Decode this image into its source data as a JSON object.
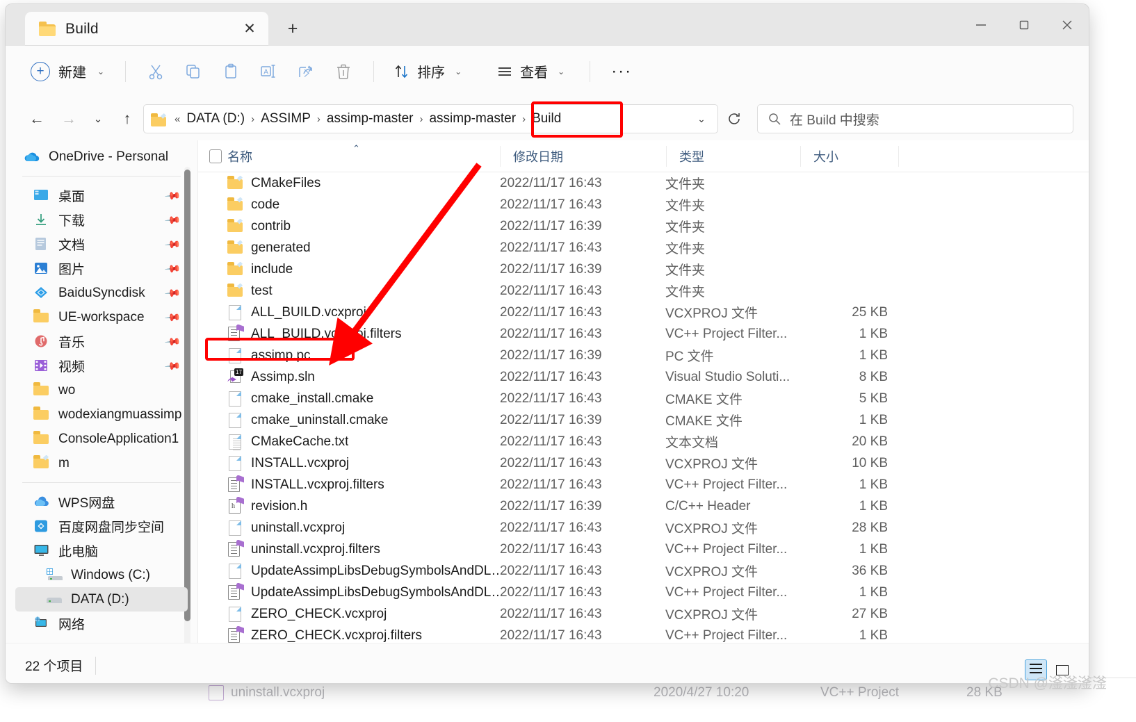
{
  "window": {
    "tab_title": "Build",
    "tab_close_glyph": "✕",
    "new_tab_glyph": "+",
    "minimize_glyph": "—",
    "maximize_glyph": "□",
    "close_glyph": "✕"
  },
  "toolbar": {
    "new_label": "新建",
    "cut_label": "剪切",
    "copy_label": "复制",
    "paste_label": "粘贴",
    "rename_label": "重命名",
    "share_label": "共享",
    "delete_label": "删除",
    "sort_label": "排序",
    "view_label": "查看",
    "more_label": "···",
    "chevron": "⌄"
  },
  "address": {
    "back_glyph": "←",
    "forward_glyph": "→",
    "recent_glyph": "⌄",
    "up_glyph": "↑",
    "prefix": "«",
    "crumbs": [
      "DATA (D:)",
      "ASSIMP",
      "assimp-master",
      "assimp-master",
      "Build"
    ],
    "separator": "›",
    "dropdown_glyph": "⌄",
    "refresh_glyph": "⟳"
  },
  "search": {
    "placeholder": "在 Build 中搜索"
  },
  "sidebar": {
    "onedrive": {
      "label": "OneDrive - Personal"
    },
    "quick": [
      {
        "label": "桌面",
        "icon": "desktop-icon",
        "pinned": true
      },
      {
        "label": "下载",
        "icon": "download-icon",
        "pinned": true
      },
      {
        "label": "文档",
        "icon": "documents-icon",
        "pinned": true
      },
      {
        "label": "图片",
        "icon": "pictures-icon",
        "pinned": true
      },
      {
        "label": "BaiduSyncdisk",
        "icon": "baidu-icon",
        "pinned": true
      },
      {
        "label": "UE-workspace",
        "icon": "folder-icon",
        "pinned": true
      },
      {
        "label": "音乐",
        "icon": "music-icon",
        "pinned": true
      },
      {
        "label": "视频",
        "icon": "video-icon",
        "pinned": true
      },
      {
        "label": "wo",
        "icon": "folder-icon",
        "pinned": false
      },
      {
        "label": "wodexiangmuassimp",
        "icon": "folder-icon",
        "pinned": false
      },
      {
        "label": "ConsoleApplication1",
        "icon": "folder-icon",
        "pinned": false
      },
      {
        "label": "m",
        "icon": "folder-shortcut-icon",
        "pinned": false
      }
    ],
    "devices": [
      {
        "label": "WPS网盘",
        "icon": "wps-cloud-icon",
        "indent": 0,
        "selected": false
      },
      {
        "label": "百度网盘同步空间",
        "icon": "baidu-cloud-icon",
        "indent": 0,
        "selected": false
      },
      {
        "label": "此电脑",
        "icon": "this-pc-icon",
        "indent": 0,
        "selected": false
      },
      {
        "label": "Windows (C:)",
        "icon": "windows-drive-icon",
        "indent": 1,
        "selected": false
      },
      {
        "label": "DATA (D:)",
        "icon": "drive-icon",
        "indent": 1,
        "selected": true
      },
      {
        "label": "网络",
        "icon": "network-icon",
        "indent": 0,
        "selected": false
      }
    ]
  },
  "columns": {
    "name": "名称",
    "date": "修改日期",
    "type": "类型",
    "size": "大小",
    "sort_caret": "⌃"
  },
  "files": [
    {
      "name": "CMakeFiles",
      "icon": "folder-shortcut-icon",
      "date": "2022/11/17 16:43",
      "type": "文件夹",
      "size": ""
    },
    {
      "name": "code",
      "icon": "folder-shortcut-icon",
      "date": "2022/11/17 16:43",
      "type": "文件夹",
      "size": ""
    },
    {
      "name": "contrib",
      "icon": "folder-shortcut-icon",
      "date": "2022/11/17 16:39",
      "type": "文件夹",
      "size": ""
    },
    {
      "name": "generated",
      "icon": "folder-shortcut-icon",
      "date": "2022/11/17 16:43",
      "type": "文件夹",
      "size": ""
    },
    {
      "name": "include",
      "icon": "folder-shortcut-icon",
      "date": "2022/11/17 16:39",
      "type": "文件夹",
      "size": ""
    },
    {
      "name": "test",
      "icon": "folder-shortcut-icon",
      "date": "2022/11/17 16:43",
      "type": "文件夹",
      "size": ""
    },
    {
      "name": "ALL_BUILD.vcxproj",
      "icon": "generic-file-icon",
      "date": "2022/11/17 16:43",
      "type": "VCXPROJ 文件",
      "size": "25 KB"
    },
    {
      "name": "ALL_BUILD.vcxproj.filters",
      "icon": "filters-file-icon",
      "date": "2022/11/17 16:43",
      "type": "VC++ Project Filter...",
      "size": "1 KB"
    },
    {
      "name": "assimp.pc",
      "icon": "generic-file-icon",
      "date": "2022/11/17 16:39",
      "type": "PC 文件",
      "size": "1 KB"
    },
    {
      "name": "Assimp.sln",
      "icon": "visual-studio-sln-icon",
      "date": "2022/11/17 16:43",
      "type": "Visual Studio Soluti...",
      "size": "8 KB"
    },
    {
      "name": "cmake_install.cmake",
      "icon": "generic-file-icon",
      "date": "2022/11/17 16:43",
      "type": "CMAKE 文件",
      "size": "5 KB"
    },
    {
      "name": "cmake_uninstall.cmake",
      "icon": "generic-file-icon",
      "date": "2022/11/17 16:39",
      "type": "CMAKE 文件",
      "size": "1 KB"
    },
    {
      "name": "CMakeCache.txt",
      "icon": "text-file-icon",
      "date": "2022/11/17 16:43",
      "type": "文本文档",
      "size": "20 KB"
    },
    {
      "name": "INSTALL.vcxproj",
      "icon": "generic-file-icon",
      "date": "2022/11/17 16:43",
      "type": "VCXPROJ 文件",
      "size": "10 KB"
    },
    {
      "name": "INSTALL.vcxproj.filters",
      "icon": "filters-file-icon",
      "date": "2022/11/17 16:43",
      "type": "VC++ Project Filter...",
      "size": "1 KB"
    },
    {
      "name": "revision.h",
      "icon": "header-file-icon",
      "date": "2022/11/17 16:39",
      "type": "C/C++ Header",
      "size": "1 KB"
    },
    {
      "name": "uninstall.vcxproj",
      "icon": "generic-file-icon",
      "date": "2022/11/17 16:43",
      "type": "VCXPROJ 文件",
      "size": "28 KB"
    },
    {
      "name": "uninstall.vcxproj.filters",
      "icon": "filters-file-icon",
      "date": "2022/11/17 16:43",
      "type": "VC++ Project Filter...",
      "size": "1 KB"
    },
    {
      "name": "UpdateAssimpLibsDebugSymbolsAndDL…",
      "icon": "generic-file-icon",
      "date": "2022/11/17 16:43",
      "type": "VCXPROJ 文件",
      "size": "36 KB"
    },
    {
      "name": "UpdateAssimpLibsDebugSymbolsAndDL…",
      "icon": "filters-file-icon",
      "date": "2022/11/17 16:43",
      "type": "VC++ Project Filter...",
      "size": "1 KB"
    },
    {
      "name": "ZERO_CHECK.vcxproj",
      "icon": "generic-file-icon",
      "date": "2022/11/17 16:43",
      "type": "VCXPROJ 文件",
      "size": "27 KB"
    },
    {
      "name": "ZERO_CHECK.vcxproj.filters",
      "icon": "filters-file-icon",
      "date": "2022/11/17 16:43",
      "type": "VC++ Project Filter...",
      "size": "1 KB"
    }
  ],
  "status": {
    "item_count": "22 个项目"
  },
  "viewbuttons": {
    "details_label": "详细信息",
    "preview_label": "预览窗格"
  },
  "watermark": {
    "text": "CSDN @滏滏滏滏"
  },
  "background_window": {
    "name": "uninstall.vcxproj",
    "date": "2020/4/27 10:20",
    "type": "VC++ Project",
    "size": "28 KB"
  },
  "annotation": {
    "color": "#ff0000",
    "targets": [
      "address-crumb-build",
      "file-row-assimp-sln"
    ]
  }
}
